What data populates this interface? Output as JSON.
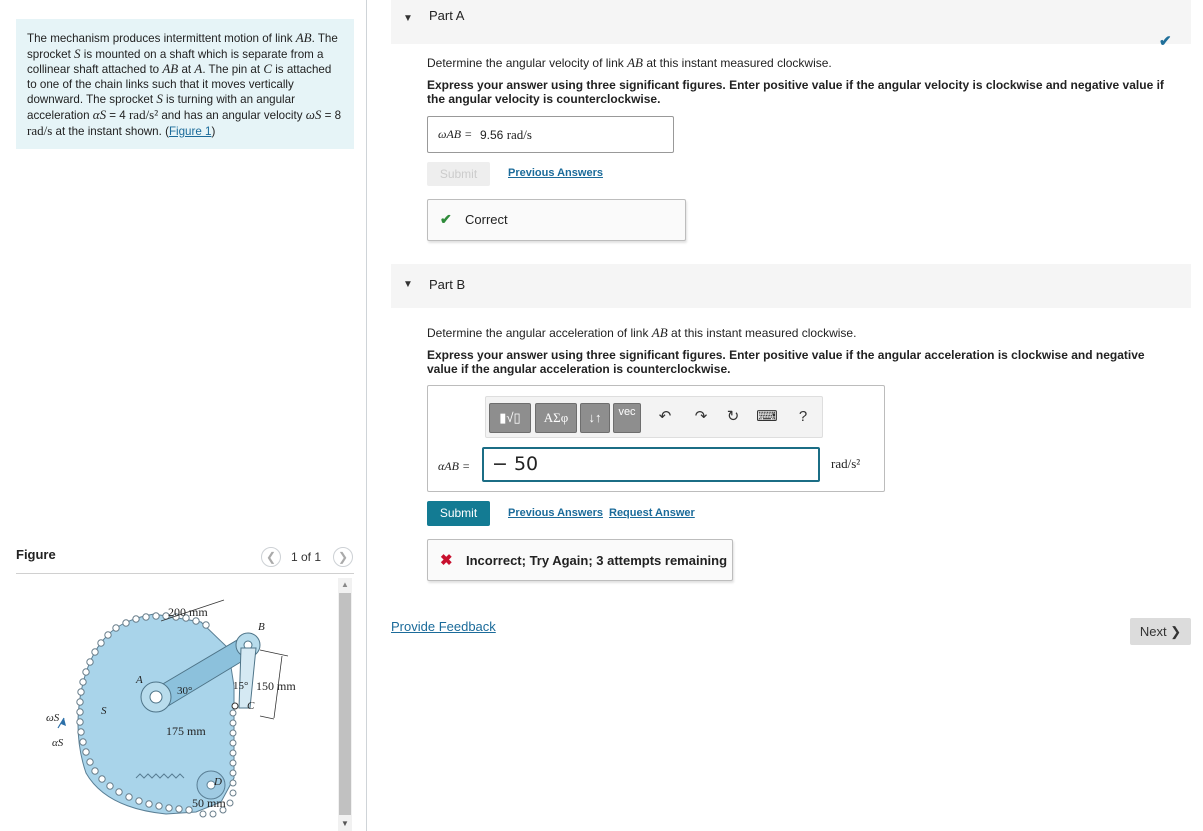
{
  "problem": {
    "t1": "The mechanism produces intermittent motion of link ",
    "ab1": "AB",
    "t2": ". The sprocket ",
    "s1": "S",
    "t3": " is mounted on a shaft which is separate from a collinear shaft attached to ",
    "ab2": "AB",
    "t4": " at ",
    "a1": "A",
    "t5": ". The pin at ",
    "c1": "C",
    "t6": " is attached to one of the chain links such that it moves vertically downward. The sprocket ",
    "s2": "S",
    "t7": " is turning with an angular acceleration ",
    "alpha_sym": "αS",
    "t8": " = 4 ",
    "alpha_unit": "rad/s²",
    "t9": " and has an angular velocity ",
    "omega_sym": "ωS",
    "t10": " = 8 ",
    "omega_unit": "rad/s",
    "t11": " at the instant shown. (",
    "figure_link": "Figure 1",
    "t12": ")"
  },
  "figure": {
    "title": "Figure",
    "counter": "1 of 1",
    "labels": {
      "dim_200": "200 mm",
      "B": "B",
      "A": "A",
      "angle_30": "30°",
      "angle_15": "15°",
      "dim_150": "150 mm",
      "C": "C",
      "S": "S",
      "omega_s": "ωS",
      "alpha_s": "αS",
      "dim_175": "175 mm",
      "D": "D",
      "dim_50": "50 mm"
    }
  },
  "partA": {
    "label": "Part A",
    "q_prefix": "Determine the angular velocity of link ",
    "q_link": "AB",
    "q_suffix": " at this instant measured clockwise.",
    "instructions": "Express your answer using three significant figures. Enter positive value if the angular velocity is clockwise and negative value if the angular velocity is counterclockwise.",
    "answer_lhs": "ωAB =",
    "answer_value": "9.56",
    "answer_unit": "rad/s",
    "submit_label": "Submit",
    "previous_answers": "Previous Answers",
    "result": "Correct"
  },
  "partB": {
    "label": "Part B",
    "q_prefix": "Determine the angular acceleration of link ",
    "q_link": "AB",
    "q_suffix": " at this instant measured clockwise.",
    "instructions": "Express your answer using three significant figures. Enter positive value if the angular acceleration is clockwise and negative value if the angular acceleration is counterclockwise.",
    "toolbar": {
      "templates": "▮√▯",
      "greek": "ΑΣφ",
      "updown": "↓↑",
      "vec": "vec",
      "undo": "↶",
      "redo": "↷",
      "reset": "↻",
      "keyboard": "⌨",
      "help": "?"
    },
    "answer_lhs": "αAB =",
    "answer_value": "− 50",
    "answer_unit": "rad/s²",
    "submit_label": "Submit",
    "previous_answers": "Previous Answers",
    "request_answer": "Request Answer",
    "result": "Incorrect; Try Again; 3 attempts remaining"
  },
  "footer": {
    "feedback": "Provide Feedback",
    "next": "Next ❯"
  },
  "colors": {
    "accent": "#137b93",
    "link": "#1b6b9a",
    "correct": "#2e8b3a",
    "incorrect": "#c8102e",
    "problem_bg": "#e6f4f7",
    "sprocket_fill": "#a9d4ea"
  }
}
